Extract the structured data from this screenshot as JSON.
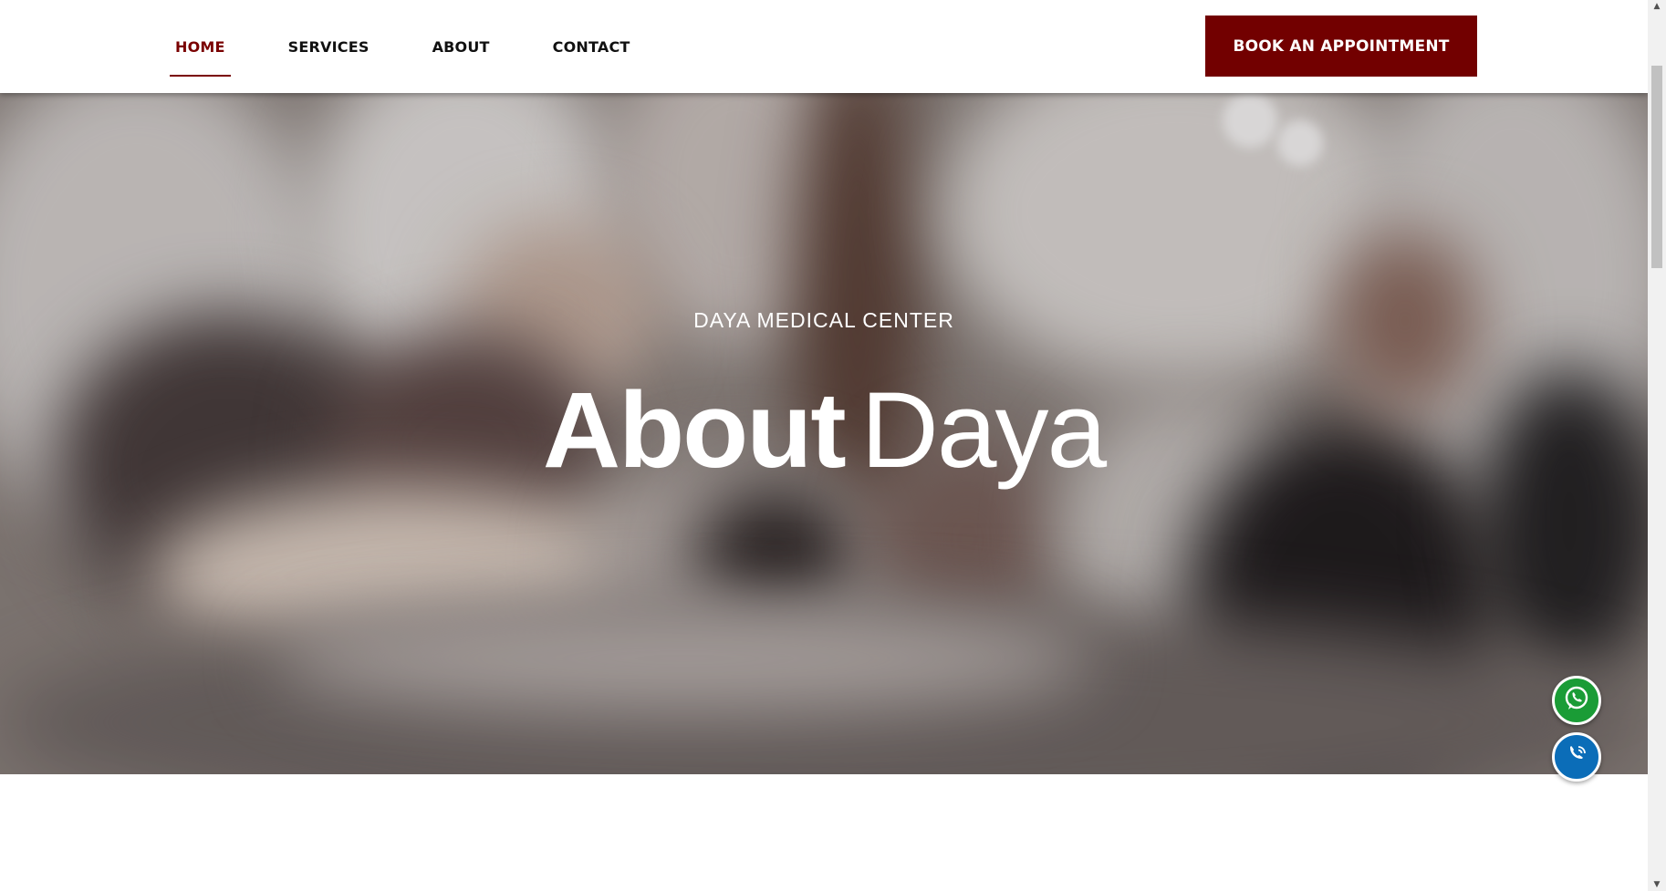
{
  "nav": {
    "items": [
      {
        "label": "HOME",
        "active": true
      },
      {
        "label": "SERVICES",
        "active": false
      },
      {
        "label": "ABOUT",
        "active": false
      },
      {
        "label": "CONTACT",
        "active": false
      }
    ],
    "cta_label": "BOOK AN APPOINTMENT"
  },
  "hero": {
    "subtitle": "DAYA MEDICAL CENTER",
    "title_bold": "About",
    "title_light": "Daya",
    "background": "blurred office photo"
  },
  "floating": {
    "whatsapp_icon": "whatsapp-icon",
    "call_icon": "phone-icon"
  },
  "colors": {
    "brand": "#720000",
    "active_nav": "#7a0000",
    "whatsapp": "#1a9c36",
    "call": "#0b6db8"
  }
}
